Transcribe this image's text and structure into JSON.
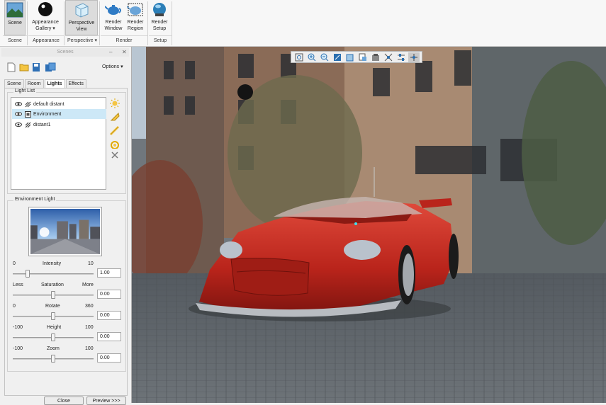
{
  "ribbon": {
    "buttons": [
      {
        "key": "scene",
        "label": "Scene"
      },
      {
        "key": "appearance_gallery",
        "label": "Appearance\nGallery ▾"
      },
      {
        "key": "perspective_view",
        "label": "Perspective\nView"
      },
      {
        "key": "render_window",
        "label": "Render\nWindow"
      },
      {
        "key": "render_region",
        "label": "Render\nRegion"
      },
      {
        "key": "render_setup",
        "label": "Render\nSetup"
      }
    ],
    "groups": {
      "scene": "Scene",
      "appearance": "Appearance",
      "perspective": "Perspective ▾",
      "render": "Render",
      "setup": "Setup"
    }
  },
  "panel": {
    "title": "Scenes",
    "options_label": "Options ▾",
    "tabs": [
      "Scene",
      "Room",
      "Lights",
      "Effects"
    ],
    "selected_tab": "Lights",
    "light_list_label": "Light List",
    "lights": [
      "default distant",
      "Environment",
      "distant1"
    ],
    "selected_light": "Environment",
    "env_light_label": "Environment Light",
    "sliders": {
      "intensity": {
        "label": "Intensity",
        "min": "0",
        "max": "10",
        "value": "1.00",
        "level": 0.1
      },
      "saturation": {
        "label": "Saturation",
        "min": "Less",
        "max": "More",
        "value": "0.00",
        "level": 0.5
      },
      "rotate": {
        "label": "Rotate",
        "min": "0",
        "max": "360",
        "value": "0.00",
        "level": 0.5
      },
      "height": {
        "label": "Height",
        "min": "-100",
        "max": "100",
        "value": "0.00",
        "level": 0.5
      },
      "zoom": {
        "label": "Zoom",
        "min": "-100",
        "max": "100",
        "value": "0.00",
        "level": 0.5
      }
    },
    "buttons": {
      "close": "Close",
      "preview": "Preview >>>"
    }
  },
  "colors": {
    "accent": "#cde8f7",
    "car": "#c42c22"
  }
}
